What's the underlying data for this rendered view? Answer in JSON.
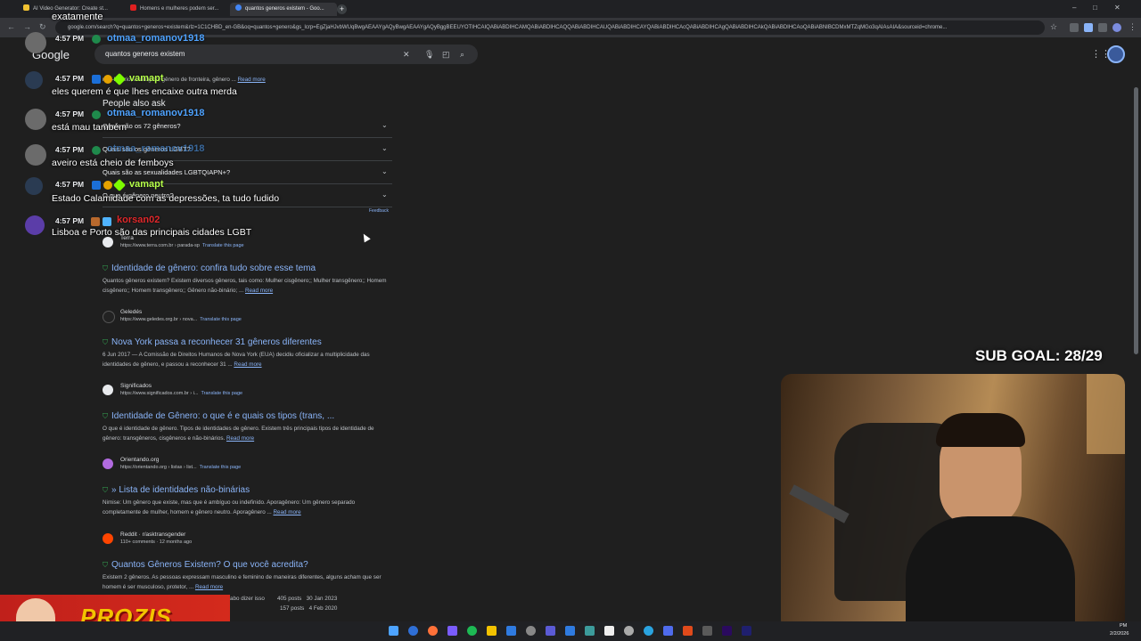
{
  "browser": {
    "tabs": [
      {
        "title": "AI Video Generator: Create st...",
        "active": false
      },
      {
        "title": "Homens e mulheres podem ser...",
        "active": false
      },
      {
        "title": "quantos generos existem - Goo...",
        "active": true
      }
    ],
    "new_tab": "+",
    "url": "google.com/search?q=quantos+generos+existem&rlz=1C1CHBD_en-GB&oq=quantos+genero&gs_lcrp=EgZjaHJvbWUqBwgAEAAYgAQyBwgAEAAYgAQyBggBEEUYOTIHCAIQABiABDIHCAMQABiABDIHCAQQABiABDIHCAUQABiABDIHCAYQABiABDIHCAcQABiABDIHCAgQABiABDIHCAkQABiABDIHCAoQABiABNIBCDMxMTZqMGo3qAIAsAIA&sourceid=chrome...",
    "window_controls": [
      "–",
      "□",
      "✕"
    ]
  },
  "google": {
    "logo": "Google",
    "query": "quantos generos existem",
    "top_snippet_end": "não-binário, andrógino, gênero de fronteira, gênero ...",
    "read_more": "Read more",
    "paa": {
      "title": "People also ask",
      "questions": [
        "Quais são os 72 gêneros?",
        "Quais são os gêneros LGBT?",
        "Quais são as sexualidades LGBTQIAPN+?",
        "O que é gênero neutro?"
      ],
      "feedback": "Feedback"
    },
    "results": [
      {
        "source": "Terra",
        "url": "https://www.terra.com.br › parada-sp",
        "translate": "Translate this page",
        "title": "Identidade de gênero: confira tudo sobre esse tema",
        "snippet": "Quantos gêneros existem? Existem diversos gêneros, tais como: Mulher cisgênero;; Mulher transgênero;; Homem cisgênero;; Homem transgênero;; Gênero não-binário; ...",
        "read_more": "Read more",
        "icon_color": "#e8eaed"
      },
      {
        "source": "Geledés",
        "url": "https://www.geledes.org.br › nova...",
        "translate": "Translate this page",
        "title": "Nova York passa a reconhecer 31 gêneros diferentes",
        "snippet": "6 Jun 2017 — A Comissão de Direitos Humanos de Nova York (EUA) decidiu oficializar a multiplicidade das identidades de gênero, e passou a reconhecer 31 ...",
        "read_more": "Read more",
        "icon_color": "#222222"
      },
      {
        "source": "Significados",
        "url": "https://www.significados.com.br › i...",
        "translate": "Translate this page",
        "title": "Identidade de Gênero: o que é e quais os tipos (trans, ...",
        "snippet": "O que é identidade de gênero. Tipos de identidades de gênero. Existem três principais tipos de identidade de gênero: transgêneros, cisgêneros e não-binários.",
        "read_more": "Read more",
        "icon_color": "#e8eaed"
      },
      {
        "source": "Orientando.org",
        "url": "https://orientando.org › listas › list...",
        "translate": "Translate this page",
        "title": "» Lista de identidades não-binárias",
        "snippet": "Nimise: Um gênero que existe, mas que é ambíguo ou indefinido. Aporagênero: Um gênero separado completamente de mulher, homem e gênero neutro. Aporagênero ...",
        "read_more": "Read more",
        "icon_color": "#b26be0"
      },
      {
        "source": "Reddit · r/asktransgender",
        "url": "110+ comments · 12 months ago",
        "translate": "",
        "title": "Quantos Gêneros Existem? O que você acredita?",
        "snippet": "Existem 2 gêneros. As pessoas expressam masculino e feminino de maneiras diferentes, alguns acham que ser homem é ser musculoso, protetor, ...",
        "read_more": "Read more",
        "icon_color": "#ff4500"
      }
    ],
    "bottom_line": {
      "left": "abo dizer isso",
      "posts1": "405 posts",
      "date1": "30 Jan 2023",
      "posts2": "157 posts",
      "date2": "4 Feb 2020"
    }
  },
  "chat": {
    "top_fragment": "exatamente",
    "messages": [
      {
        "time": "4:57 PM",
        "user": "otmaa_romanov1918",
        "user_color": "#4fa3ff",
        "text": "eles querem é que lhes encaixe outra merda"
      },
      {
        "time": "4:57 PM",
        "user": "vamapt",
        "user_color": "#b6ff4a",
        "text": ""
      },
      {
        "time": "4:57 PM",
        "user": "otmaa_romanov1918",
        "user_color": "#4fa3ff",
        "text": "está mau também"
      },
      {
        "time": "4:57 PM",
        "user": "otmaa_romanov1918",
        "user_color": "#4fa3ff",
        "text": "aveiro está cheio de femboys"
      },
      {
        "time": "4:57 PM",
        "user": "vamapt",
        "user_color": "#b6ff4a",
        "text": "Estado Calamidade com as depressões, ta tudo fudido"
      },
      {
        "time": "4:57 PM",
        "user": "korsan02",
        "user_color": "#e0282b",
        "text": "Lisboa e Porto são das principais cidades LGBT"
      }
    ]
  },
  "stream": {
    "sub_goal": "SUB GOAL: 28/29",
    "promo_text": "PROZIS"
  },
  "taskbar": {
    "time": "PM",
    "date": "2/2/2026"
  }
}
